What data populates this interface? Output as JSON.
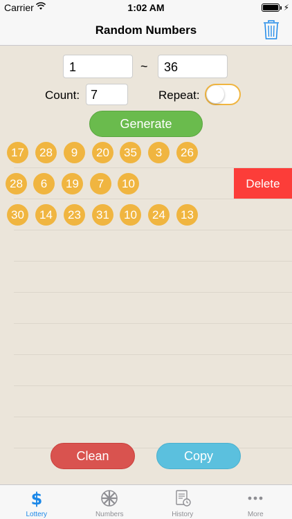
{
  "status_bar": {
    "carrier": "Carrier",
    "time": "1:02 AM",
    "battery_level": 1.0
  },
  "nav": {
    "title": "Random Numbers"
  },
  "form": {
    "min_value": "1",
    "separator": "~",
    "max_value": "36",
    "count_label": "Count:",
    "count_value": "7",
    "repeat_label": "Repeat:",
    "repeat_on": false,
    "generate_label": "Generate"
  },
  "results": [
    [
      "17",
      "28",
      "9",
      "20",
      "35",
      "3",
      "26"
    ],
    [
      "28",
      "6",
      "19",
      "7",
      "10"
    ],
    [
      "30",
      "14",
      "23",
      "31",
      "10",
      "24",
      "13"
    ]
  ],
  "delete_label": "Delete",
  "actions": {
    "clean_label": "Clean",
    "copy_label": "Copy"
  },
  "tabs": [
    {
      "label": "Lottery",
      "icon": "dollar-icon",
      "active": true
    },
    {
      "label": "Numbers",
      "icon": "wheel-icon",
      "active": false
    },
    {
      "label": "History",
      "icon": "history-icon",
      "active": false
    },
    {
      "label": "More",
      "icon": "more-icon",
      "active": false
    }
  ],
  "colors": {
    "ball": "#f0b540",
    "generate": "#6abb4d",
    "clean": "#d9534f",
    "copy": "#5bc0de",
    "delete": "#fc3d39",
    "active_tab": "#1a87e8"
  }
}
